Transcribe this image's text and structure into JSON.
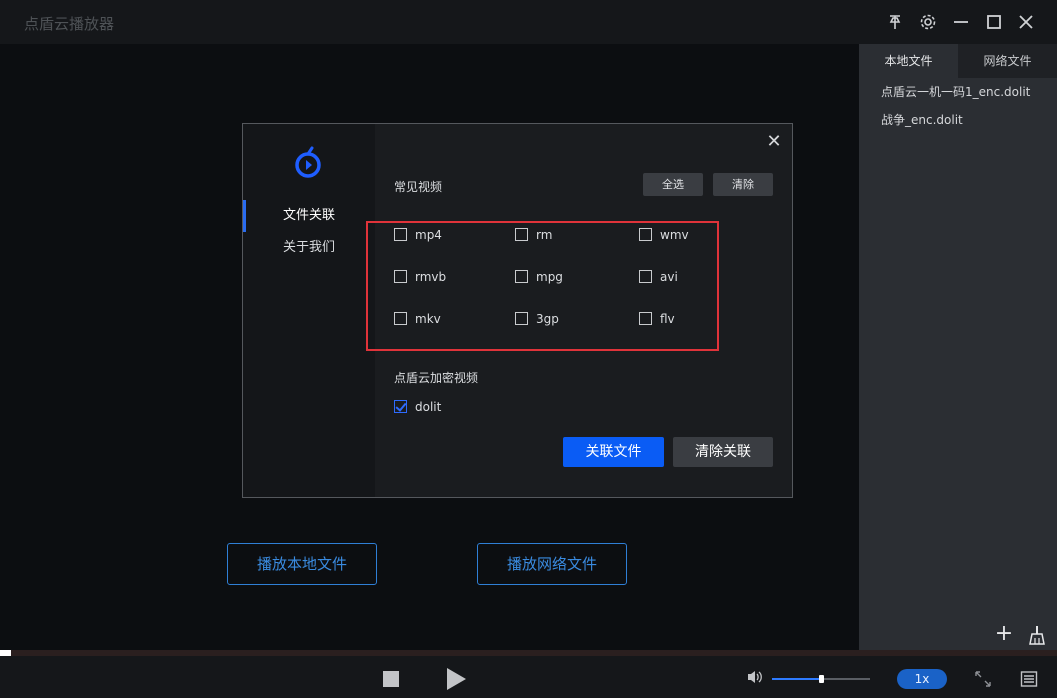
{
  "window": {
    "title": "点盾云播放器",
    "pin_icon": "pin-icon",
    "settings_icon": "gear-icon",
    "minimize_icon": "minimize-icon",
    "maximize_icon": "maximize-icon",
    "close_icon": "close-icon"
  },
  "sidebar": {
    "tabs": [
      {
        "label": "本地文件",
        "active": true
      },
      {
        "label": "网络文件",
        "active": false
      }
    ],
    "files": [
      {
        "name": "点盾云一机一码1_enc.dolit"
      },
      {
        "name": "战争_enc.dolit"
      }
    ],
    "add_label": "+"
  },
  "main": {
    "play_local_label": "播放本地文件",
    "play_network_label": "播放网络文件"
  },
  "dialog": {
    "nav": [
      {
        "label": "文件关联",
        "active": true
      },
      {
        "label": "关于我们",
        "active": false
      }
    ],
    "close_label": "✕",
    "common_section": {
      "title": "常见视频",
      "select_all_label": "全选",
      "clear_label": "清除",
      "formats": [
        {
          "label": "mp4",
          "checked": false
        },
        {
          "label": "rm",
          "checked": false
        },
        {
          "label": "wmv",
          "checked": false
        },
        {
          "label": "rmvb",
          "checked": false
        },
        {
          "label": "mpg",
          "checked": false
        },
        {
          "label": "avi",
          "checked": false
        },
        {
          "label": "mkv",
          "checked": false
        },
        {
          "label": "3gp",
          "checked": false
        },
        {
          "label": "flv",
          "checked": false
        }
      ]
    },
    "encrypted_section": {
      "title": "点盾云加密视频",
      "formats": [
        {
          "label": "dolit",
          "checked": true
        }
      ]
    },
    "associate_label": "关联文件",
    "clear_association_label": "清除关联",
    "accent_color": "#0a5cf5",
    "highlight_color": "#e0333a"
  },
  "player": {
    "progress": 0.01,
    "volume": 0.5,
    "speed_label": "1x"
  }
}
